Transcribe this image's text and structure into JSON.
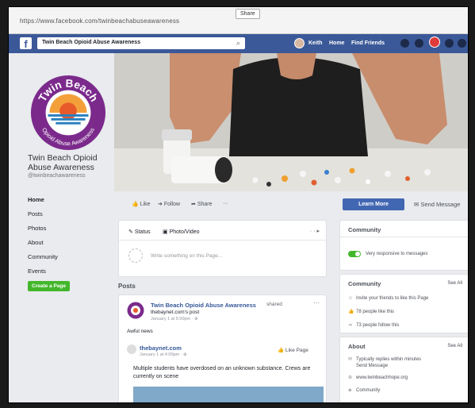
{
  "browser": {
    "url": "https://www.facebook.com/twinbeachabuseawareness",
    "share_tip": "Share"
  },
  "topbar": {
    "search_text": "Twin Beach Opioid Abuse Awareness",
    "user_name": "Keith",
    "home": "Home",
    "find_friends": "Find Friends"
  },
  "page": {
    "logo_top_text": "Twin Beach",
    "logo_bottom_text": "Opioid Abuse Awareness",
    "name": "Twin Beach Opioid Abuse Awareness",
    "handle": "@twinbeachawareness",
    "nav": [
      "Home",
      "Posts",
      "Photos",
      "About",
      "Community",
      "Events"
    ],
    "create_page": "Create a Page"
  },
  "actions": {
    "like": "Like",
    "follow": "Follow",
    "share": "Share",
    "more": "···",
    "learn_more": "Learn More",
    "send_message": "Send Message"
  },
  "composer": {
    "status": "Status",
    "photo_video": "Photo/Video",
    "placeholder": "Write something on this Page..."
  },
  "posts_label": "Posts",
  "post": {
    "author": "Twin Beach Opioid Abuse Awareness",
    "shared_word": "shared",
    "shared_line": "thebaynet.com's post",
    "date": "January 1 at 5:00pm · ⊕",
    "text": "Awful news",
    "inner_name": "thebaynet.com",
    "inner_date": "January 1 at 4:00pm · ⊕",
    "like_page": "Like Page",
    "inner_text": "Multiple students have overdosed on an unknown substance. Crews are currently on scene"
  },
  "right": {
    "community_title": "Community",
    "responsive": "Very responsive to messages",
    "community2_title": "Community",
    "see_all": "See All",
    "invite": "Invite your friends to like this Page",
    "likes": "78 people like this",
    "follows": "73 people follow this",
    "about_title": "About",
    "see_all2": "See All",
    "reply_time": "Typically replies within minutes",
    "send_message": "Send Message",
    "website": "www.twinbeachhope.org",
    "category": "Community"
  }
}
